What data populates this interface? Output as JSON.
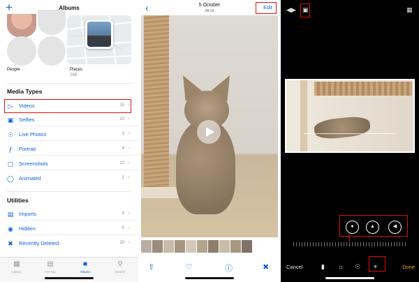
{
  "albums": {
    "title": "Albums",
    "people_label": "People",
    "places_label": "Places",
    "places_count": "266",
    "media_types_title": "Media Types",
    "media_types": [
      {
        "label": "Videos",
        "count": "15",
        "icon": "video-icon"
      },
      {
        "label": "Selfies",
        "count": "10",
        "icon": "selfie-icon"
      },
      {
        "label": "Live Photos",
        "count": "3",
        "icon": "live-photo-icon"
      },
      {
        "label": "Portrait",
        "count": "4",
        "icon": "portrait-icon"
      },
      {
        "label": "Screenshots",
        "count": "13",
        "icon": "screenshot-icon"
      },
      {
        "label": "Animated",
        "count": "2",
        "icon": "animated-icon"
      }
    ],
    "utilities_title": "Utilities",
    "utilities": [
      {
        "label": "Imports",
        "count": "9",
        "icon": "import-icon"
      },
      {
        "label": "Hidden",
        "count": "0",
        "icon": "hidden-icon"
      },
      {
        "label": "Recently Deleted",
        "count": "20",
        "icon": "trash-icon"
      }
    ],
    "tabs": [
      {
        "label": "Library",
        "active": false
      },
      {
        "label": "For You",
        "active": false
      },
      {
        "label": "Albums",
        "active": true
      },
      {
        "label": "Search",
        "active": false
      }
    ]
  },
  "viewer": {
    "date": "5 October",
    "time": "09:16",
    "edit_label": "Edit"
  },
  "editor": {
    "cancel_label": "Cancel",
    "done_label": "Done"
  },
  "colors": {
    "accent": "#0a62d6",
    "highlight": "#e10d0d",
    "done": "#f2b705"
  }
}
